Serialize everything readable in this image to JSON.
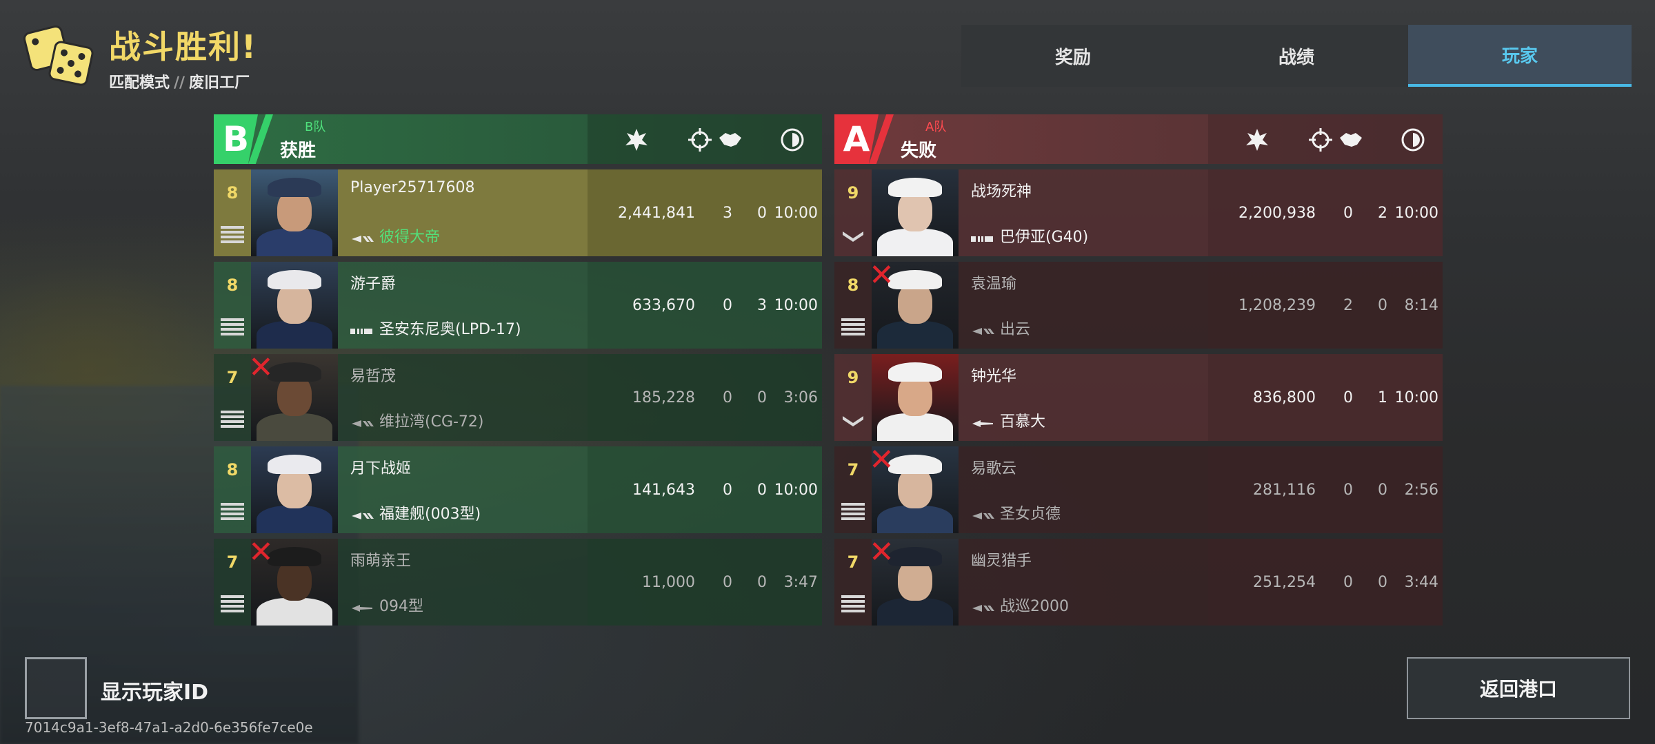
{
  "header": {
    "title": "战斗胜利!",
    "mode": "匹配模式",
    "separator": "//",
    "map": "废旧工厂"
  },
  "tabs": [
    {
      "label": "奖励",
      "active": false
    },
    {
      "label": "战绩",
      "active": false
    },
    {
      "label": "玩家",
      "active": true
    }
  ],
  "team_b": {
    "letter": "B",
    "tag": "B队",
    "result": "获胜",
    "accent": "#35d16a",
    "columns": [
      "damage-icon",
      "kill-icon",
      "assist-icon",
      "time-icon"
    ],
    "players": [
      {
        "level": "8",
        "rank_icon": "rank-bars-icon",
        "name": "Player25717608",
        "ship": "彼得大帝",
        "ship_icon": "destroyer-icon",
        "damage": "2,441,841",
        "kills": "3",
        "assists": "0",
        "time": "10:00",
        "dead": false,
        "self": true
      },
      {
        "level": "8",
        "rank_icon": "rank-bars-icon",
        "name": "游子爵",
        "ship": "圣安东尼奥(LPD-17)",
        "ship_icon": "carrier-icon",
        "damage": "633,670",
        "kills": "0",
        "assists": "3",
        "time": "10:00",
        "dead": false,
        "self": false
      },
      {
        "level": "7",
        "rank_icon": "rank-bars-icon",
        "name": "易哲茂",
        "ship": "维拉湾(CG-72)",
        "ship_icon": "destroyer-icon",
        "damage": "185,228",
        "kills": "0",
        "assists": "0",
        "time": "3:06",
        "dead": true,
        "self": false
      },
      {
        "level": "8",
        "rank_icon": "rank-bars-icon",
        "name": "月下战姬",
        "ship": "福建舰(003型)",
        "ship_icon": "destroyer-icon",
        "damage": "141,643",
        "kills": "0",
        "assists": "0",
        "time": "10:00",
        "dead": false,
        "self": false
      },
      {
        "level": "7",
        "rank_icon": "rank-bars-icon",
        "name": "雨萌亲王",
        "ship": "094型",
        "ship_icon": "submarine-icon",
        "damage": "11,000",
        "kills": "0",
        "assists": "0",
        "time": "3:47",
        "dead": true,
        "self": false
      }
    ]
  },
  "team_a": {
    "letter": "A",
    "tag": "A队",
    "result": "失败",
    "accent": "#e6323c",
    "columns": [
      "damage-icon",
      "kill-icon",
      "assist-icon",
      "time-icon"
    ],
    "players": [
      {
        "level": "9",
        "rank_icon": "rank-chevron-icon",
        "name": "战场死神",
        "ship": "巴伊亚(G40)",
        "ship_icon": "carrier-icon",
        "damage": "2,200,938",
        "kills": "0",
        "assists": "2",
        "time": "10:00",
        "dead": false,
        "self": false
      },
      {
        "level": "8",
        "rank_icon": "rank-bars-icon",
        "name": "袁温瑜",
        "ship": "出云",
        "ship_icon": "destroyer-icon",
        "damage": "1,208,239",
        "kills": "2",
        "assists": "0",
        "time": "8:14",
        "dead": true,
        "self": false
      },
      {
        "level": "9",
        "rank_icon": "rank-chevron-icon",
        "name": "钟光华",
        "ship": "百慕大",
        "ship_icon": "submarine-icon",
        "damage": "836,800",
        "kills": "0",
        "assists": "1",
        "time": "10:00",
        "dead": false,
        "self": false
      },
      {
        "level": "7",
        "rank_icon": "rank-bars-icon",
        "name": "易歌云",
        "ship": "圣女贞德",
        "ship_icon": "destroyer-icon",
        "damage": "281,116",
        "kills": "0",
        "assists": "0",
        "time": "2:56",
        "dead": true,
        "self": false
      },
      {
        "level": "7",
        "rank_icon": "rank-bars-icon",
        "name": "幽灵猎手",
        "ship": "战巡2000",
        "ship_icon": "destroyer-icon",
        "damage": "251,254",
        "kills": "0",
        "assists": "0",
        "time": "3:44",
        "dead": true,
        "self": false
      }
    ]
  },
  "footer": {
    "show_id_label": "显示玩家ID",
    "show_id_checked": false,
    "uuid": "7014c9a1-3ef8-47a1-a2d0-6e356fe7ce0e",
    "return_label": "返回港口"
  }
}
